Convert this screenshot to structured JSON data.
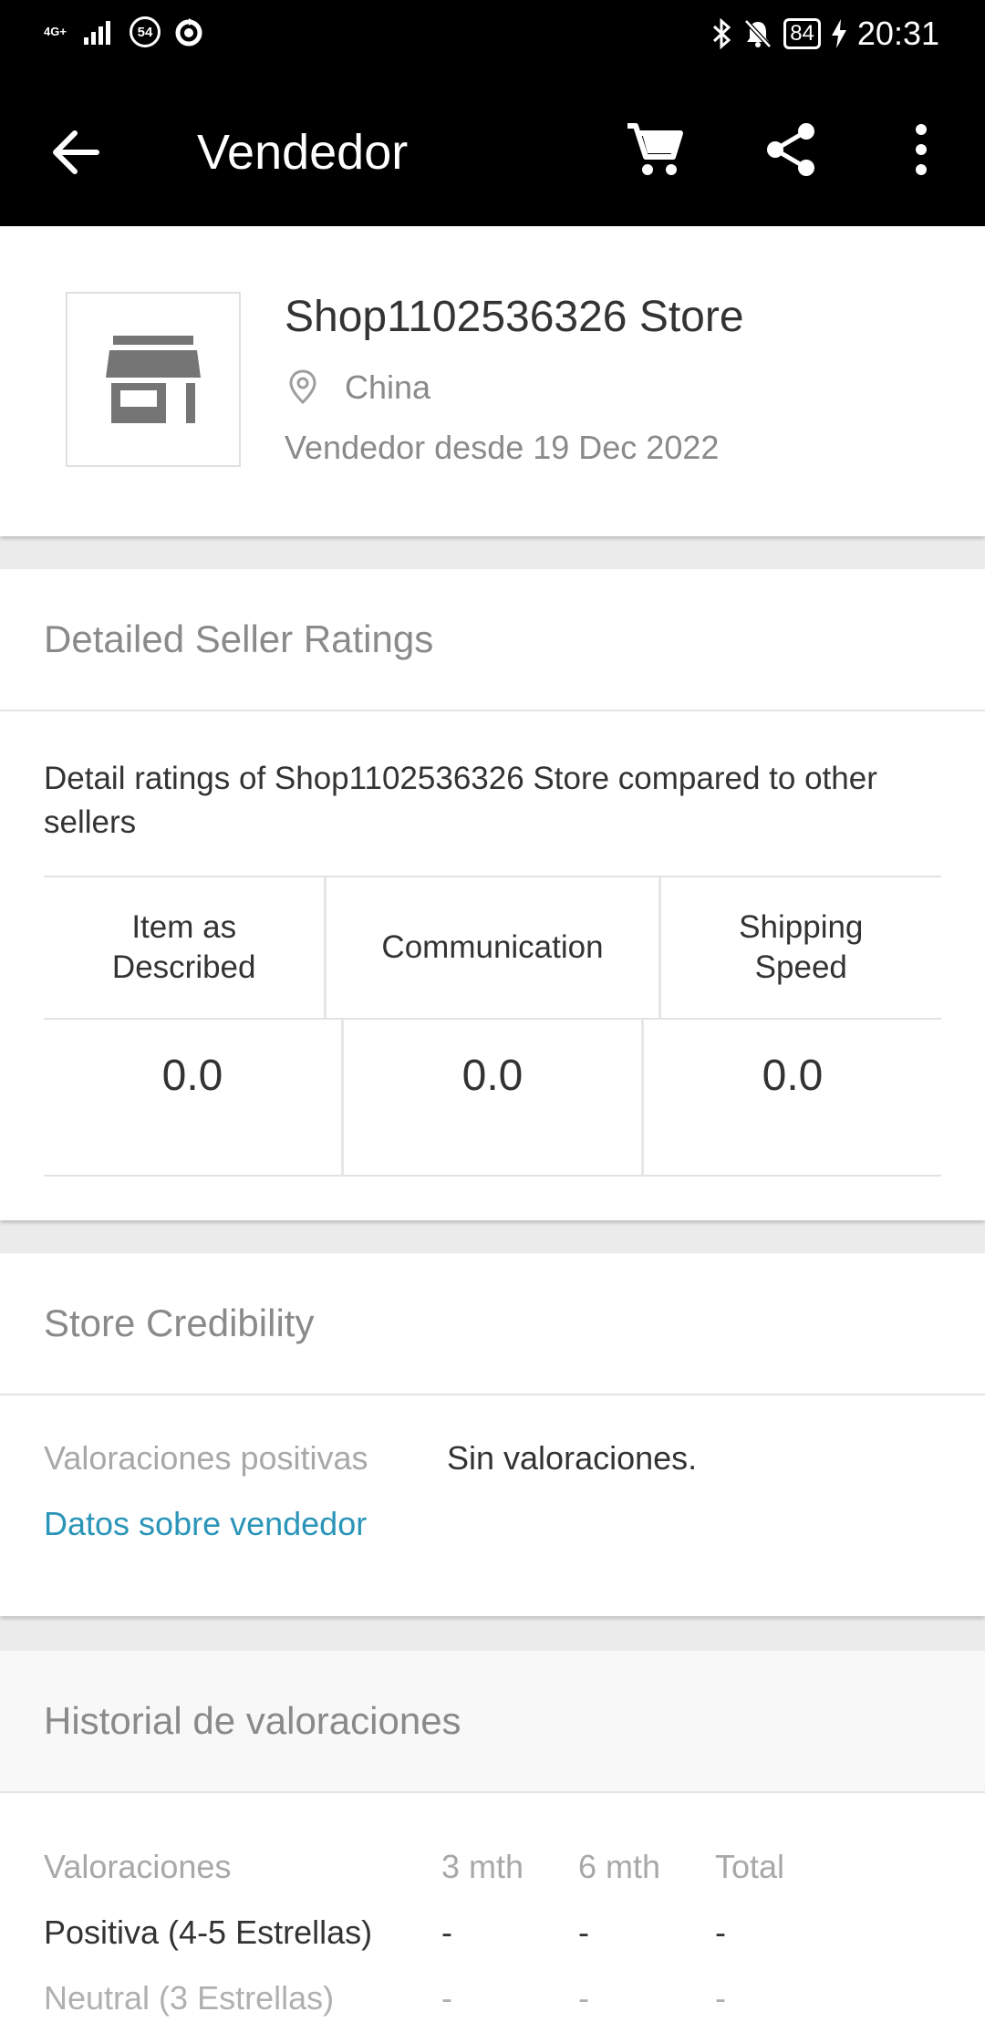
{
  "status_bar": {
    "network": "4G+",
    "notif_count": "54",
    "battery": "84",
    "time": "20:31"
  },
  "app_bar": {
    "title": "Vendedor"
  },
  "seller": {
    "name": "Shop1102536326 Store",
    "country": "China",
    "since": "Vendedor desde 19 Dec 2022"
  },
  "ratings": {
    "header": "Detailed Seller Ratings",
    "description": "Detail ratings of Shop1102536326 Store compared to other sellers",
    "columns": [
      {
        "label": "Item as Described",
        "value": "0.0"
      },
      {
        "label": "Communication",
        "value": "0.0"
      },
      {
        "label": "Shipping Speed",
        "value": "0.0"
      }
    ]
  },
  "credibility": {
    "header": "Store Credibility",
    "positive_label": "Valoraciones positivas",
    "positive_value": "Sin valoraciones.",
    "link": "Datos sobre vendedor"
  },
  "history": {
    "header": "Historial de valoraciones",
    "columns": [
      "Valoraciones",
      "3 mth",
      "6 mth",
      "Total"
    ],
    "rows": [
      {
        "label": "Positiva (4-5 Estrellas)",
        "v3": "-",
        "v6": "-",
        "total": "-"
      },
      {
        "label": "Neutral (3 Estrellas)",
        "v3": "-",
        "v6": "-",
        "total": "-"
      }
    ]
  },
  "icons": [
    "back-arrow-icon",
    "cart-icon",
    "share-icon",
    "more-vert-icon",
    "store-icon",
    "location-pin-icon",
    "bluetooth-icon",
    "bell-off-icon",
    "charging-icon"
  ],
  "colors": {
    "link": "#2a95b8",
    "appbar": "#000000"
  }
}
